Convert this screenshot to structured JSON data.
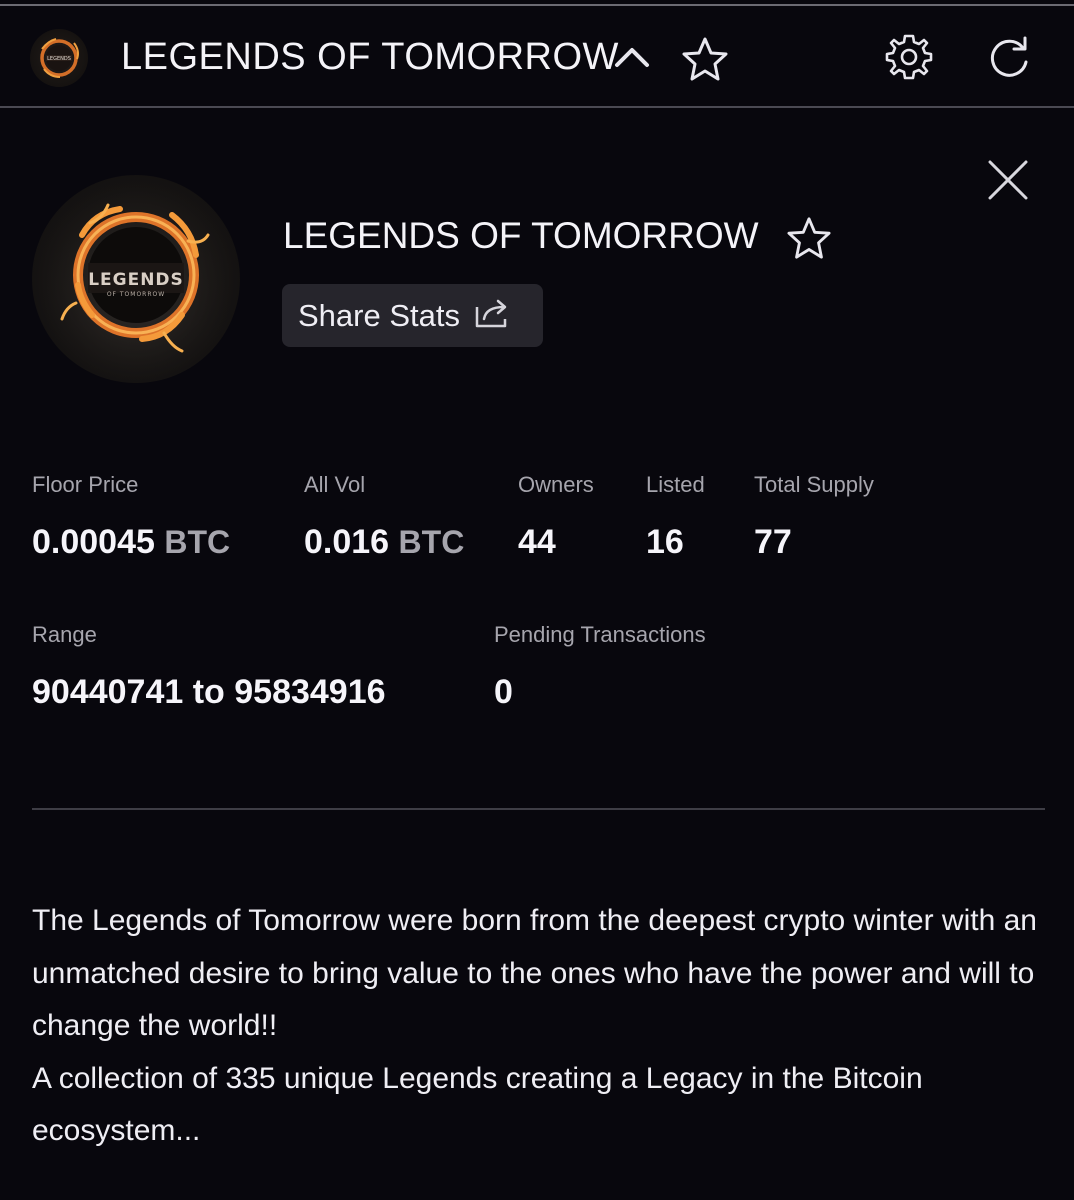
{
  "header": {
    "title": "LEGENDS OF TOMORROW",
    "icons": [
      "chevron-up-icon",
      "star-icon",
      "gear-icon",
      "refresh-icon"
    ]
  },
  "collection": {
    "name": "LEGENDS OF TOMORROW",
    "logo_text": "LEGENDS",
    "logo_subtext": "OF TOMORROW",
    "share_label": "Share Stats"
  },
  "stats": {
    "floor_price": {
      "label": "Floor Price",
      "value": "0.00045",
      "unit": "BTC"
    },
    "all_vol": {
      "label": "All Vol",
      "value": "0.016",
      "unit": "BTC"
    },
    "owners": {
      "label": "Owners",
      "value": "44"
    },
    "listed": {
      "label": "Listed",
      "value": "16"
    },
    "total_supply": {
      "label": "Total Supply",
      "value": "77"
    },
    "range": {
      "label": "Range",
      "value": "90440741 to 95834916"
    },
    "pending": {
      "label": "Pending Transactions",
      "value": "0"
    }
  },
  "description": {
    "line1": "The Legends of Tomorrow were born from the deepest crypto winter with an unmatched desire to bring value to the ones who have the power and will to change the world!!",
    "line2": "A collection of 335 unique Legends creating a Legacy in the Bitcoin ecosystem..."
  },
  "colors": {
    "background": "#08070d",
    "button_bg": "#26252c",
    "muted_text": "#a6a5ad",
    "fire_orange": "#e8782a"
  }
}
